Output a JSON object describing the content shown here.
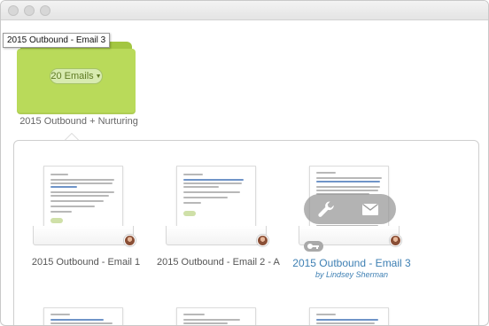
{
  "tooltip": "2015 Outbound - Email 3",
  "folder": {
    "emails_count_label": "20 Emails",
    "title": "2015 Outbound + Nurturing"
  },
  "cards": [
    {
      "title": "2015 Outbound - Email 1",
      "byline": ""
    },
    {
      "title": "2015 Outbound - Email 2 - A…",
      "byline": ""
    },
    {
      "title": "2015 Outbound - Email 3",
      "byline": "by Lindsey Sherman"
    }
  ],
  "icons": [
    "wrench-icon",
    "mail-icon",
    "key-icon",
    "caret-down-icon"
  ],
  "colors": {
    "folder_green": "#b9da5a",
    "link_blue": "#3d7fb3"
  }
}
